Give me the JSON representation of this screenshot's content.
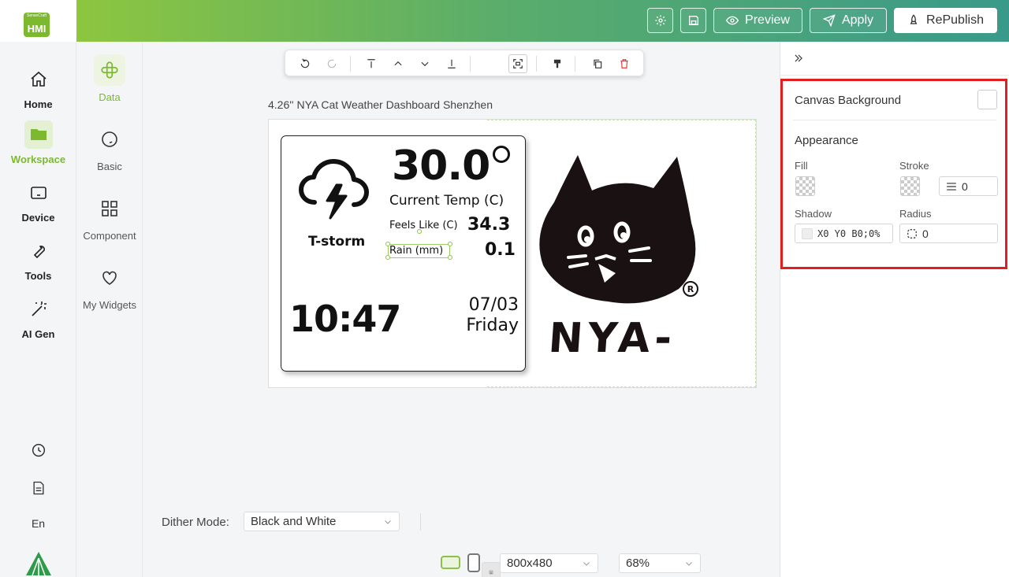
{
  "header": {
    "logo_brand": "SenseCraft",
    "logo_text": "HMI",
    "preview_label": "Preview",
    "apply_label": "Apply",
    "republish_label": "RePublish"
  },
  "leftnav": {
    "items": [
      {
        "label": "Home",
        "icon": "home-icon"
      },
      {
        "label": "Workspace",
        "icon": "folder-icon"
      },
      {
        "label": "Device",
        "icon": "device-icon"
      },
      {
        "label": "Tools",
        "icon": "wrench-icon"
      },
      {
        "label": "AI Gen",
        "icon": "magic-wand-icon"
      }
    ],
    "language": "En"
  },
  "subnav": {
    "items": [
      {
        "label": "Data"
      },
      {
        "label": "Basic"
      },
      {
        "label": "Component"
      },
      {
        "label": "My Widgets"
      }
    ]
  },
  "canvas": {
    "title": "4.26'' NYA Cat Weather Dashboard Shenzhen",
    "weather": {
      "temp": "30.0",
      "temp_label": "Current Temp (C)",
      "feels_label": "Feels Like (C)",
      "feels_value": "34.3",
      "rain_label": "Rain (mm)",
      "rain_value": "0.1",
      "condition": "T-storm",
      "time": "10:47",
      "date": "07/03",
      "weekday": "Friday"
    },
    "brand_text": "NYA-",
    "registered_mark": "R"
  },
  "bottombar": {
    "dither_label": "Dither Mode:",
    "dither_value": "Black and White",
    "resolution": "800x480",
    "zoom": "68%"
  },
  "rightpanel": {
    "canvas_background_label": "Canvas Background",
    "appearance_label": "Appearance",
    "fill_label": "Fill",
    "stroke_label": "Stroke",
    "stroke_value": "0",
    "shadow_label": "Shadow",
    "shadow_value": "X0 Y0 B0;0%",
    "radius_label": "Radius",
    "radius_value": "0"
  },
  "colors": {
    "accent": "#7cb92f",
    "highlight_border": "#e02020"
  }
}
